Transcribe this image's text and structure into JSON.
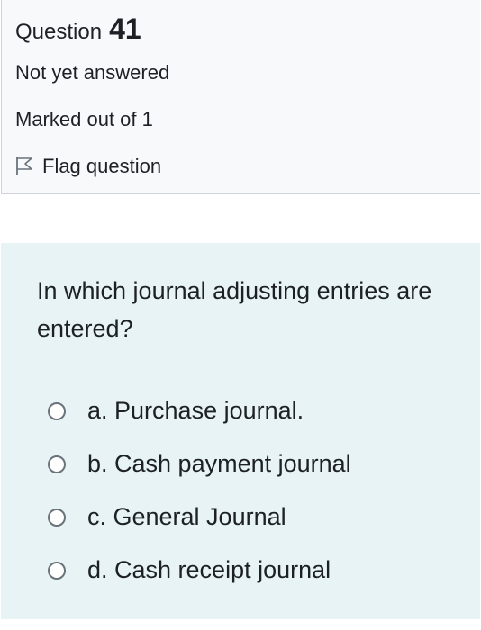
{
  "question": {
    "label": "Question",
    "number": "41",
    "state": "Not yet answered",
    "grade": "Marked out of 1",
    "flag_label": "Flag question",
    "flag_icon": "flag-outline-icon",
    "text": "In which journal adjusting entries are entered?",
    "answers": [
      {
        "label": "a. Purchase journal.",
        "selected": false
      },
      {
        "label": "b. Cash payment journal",
        "selected": false
      },
      {
        "label": "c. General Journal",
        "selected": false
      },
      {
        "label": "d. Cash receipt journal",
        "selected": false
      }
    ]
  },
  "colors": {
    "info_background": "#f8f9fa",
    "content_background": "#e7f3f5",
    "text": "#1d2125",
    "radio_border": "#6a737b"
  }
}
